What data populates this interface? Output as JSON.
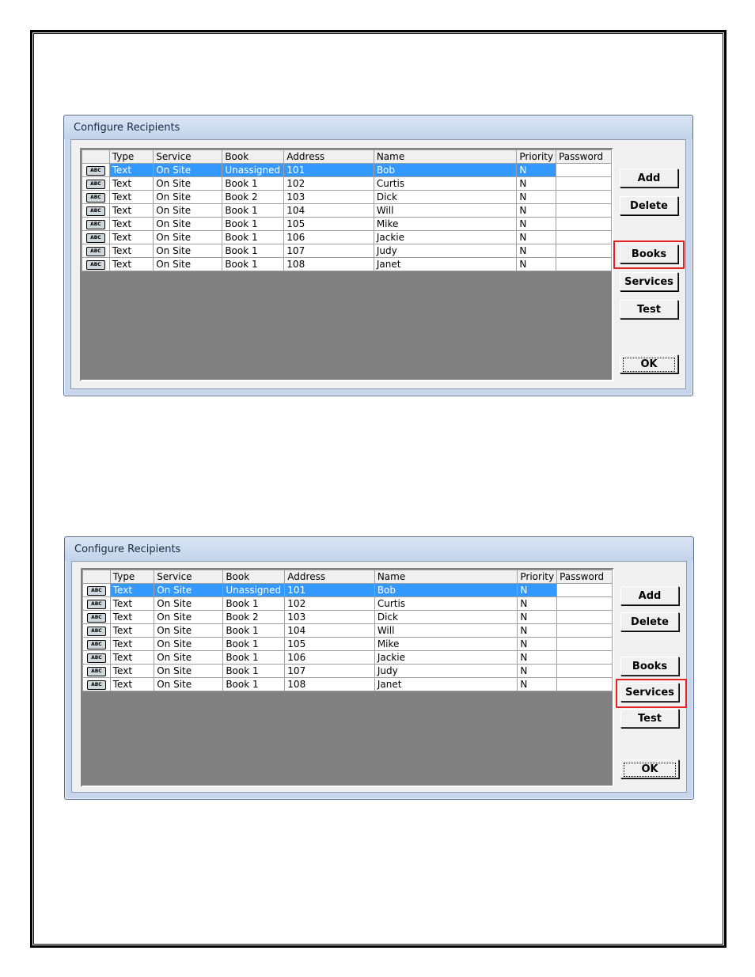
{
  "dialogs": [
    {
      "title": "Configure Recipients",
      "columns": [
        "Type",
        "Service",
        "Book",
        "Address",
        "Name",
        "Priority",
        "Password"
      ],
      "rows": [
        {
          "icon": "ABC",
          "type": "Text",
          "service": "On Site",
          "book": "Unassigned",
          "address": "101",
          "name": "Bob",
          "priority": "N",
          "password": ""
        },
        {
          "icon": "ABC",
          "type": "Text",
          "service": "On Site",
          "book": "Book 1",
          "address": "102",
          "name": "Curtis",
          "priority": "N",
          "password": ""
        },
        {
          "icon": "ABC",
          "type": "Text",
          "service": "On Site",
          "book": "Book 2",
          "address": "103",
          "name": "Dick",
          "priority": "N",
          "password": ""
        },
        {
          "icon": "ABC",
          "type": "Text",
          "service": "On Site",
          "book": "Book 1",
          "address": "104",
          "name": "Will",
          "priority": "N",
          "password": ""
        },
        {
          "icon": "ABC",
          "type": "Text",
          "service": "On Site",
          "book": "Book 1",
          "address": "105",
          "name": "Mike",
          "priority": "N",
          "password": ""
        },
        {
          "icon": "ABC",
          "type": "Text",
          "service": "On Site",
          "book": "Book 1",
          "address": "106",
          "name": "Jackie",
          "priority": "N",
          "password": ""
        },
        {
          "icon": "ABC",
          "type": "Text",
          "service": "On Site",
          "book": "Book 1",
          "address": "107",
          "name": "Judy",
          "priority": "N",
          "password": ""
        },
        {
          "icon": "ABC",
          "type": "Text",
          "service": "On Site",
          "book": "Book 1",
          "address": "108",
          "name": "Janet",
          "priority": "N",
          "password": ""
        }
      ],
      "buttons": {
        "add": "Add",
        "delete": "Delete",
        "books": "Books",
        "services": "Services",
        "test": "Test",
        "ok": "OK"
      },
      "highlighted_button": "books"
    },
    {
      "title": "Configure Recipients",
      "columns": [
        "Type",
        "Service",
        "Book",
        "Address",
        "Name",
        "Priority",
        "Password"
      ],
      "rows": [
        {
          "icon": "ABC",
          "type": "Text",
          "service": "On Site",
          "book": "Unassigned",
          "address": "101",
          "name": "Bob",
          "priority": "N",
          "password": ""
        },
        {
          "icon": "ABC",
          "type": "Text",
          "service": "On Site",
          "book": "Book 1",
          "address": "102",
          "name": "Curtis",
          "priority": "N",
          "password": ""
        },
        {
          "icon": "ABC",
          "type": "Text",
          "service": "On Site",
          "book": "Book 2",
          "address": "103",
          "name": "Dick",
          "priority": "N",
          "password": ""
        },
        {
          "icon": "ABC",
          "type": "Text",
          "service": "On Site",
          "book": "Book 1",
          "address": "104",
          "name": "Will",
          "priority": "N",
          "password": ""
        },
        {
          "icon": "ABC",
          "type": "Text",
          "service": "On Site",
          "book": "Book 1",
          "address": "105",
          "name": "Mike",
          "priority": "N",
          "password": ""
        },
        {
          "icon": "ABC",
          "type": "Text",
          "service": "On Site",
          "book": "Book 1",
          "address": "106",
          "name": "Jackie",
          "priority": "N",
          "password": ""
        },
        {
          "icon": "ABC",
          "type": "Text",
          "service": "On Site",
          "book": "Book 1",
          "address": "107",
          "name": "Judy",
          "priority": "N",
          "password": ""
        },
        {
          "icon": "ABC",
          "type": "Text",
          "service": "On Site",
          "book": "Book 1",
          "address": "108",
          "name": "Janet",
          "priority": "N",
          "password": ""
        }
      ],
      "buttons": {
        "add": "Add",
        "delete": "Delete",
        "books": "Books",
        "services": "Services",
        "test": "Test",
        "ok": "OK"
      },
      "highlighted_button": "services"
    }
  ],
  "colors": {
    "selection": "#3399ff",
    "grid_empty": "#808080",
    "highlight_box": "#e32222",
    "dialog_frame": "#c7d6ea"
  }
}
